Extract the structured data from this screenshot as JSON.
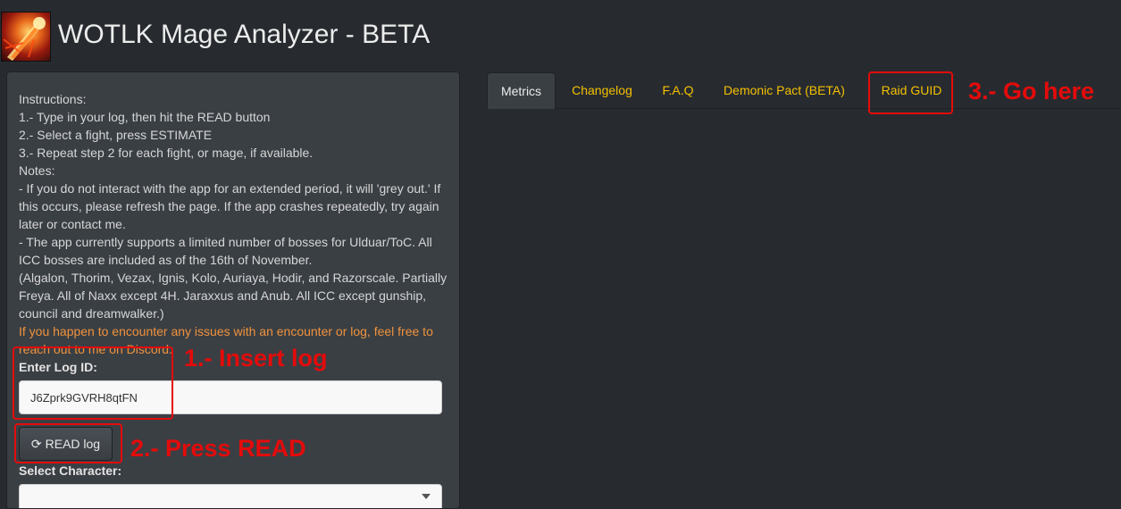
{
  "app": {
    "title": "WOTLK Mage Analyzer - BETA",
    "logo_icon": "mage-spell-icon"
  },
  "sidebar": {
    "instructions": [
      "Instructions:",
      "1.- Type in your log, then hit the READ button",
      "2.- Select a fight, press ESTIMATE",
      "3.- Repeat step 2 for each fight, or mage, if available.",
      "Notes:",
      "- If you do not interact with the app for an extended period, it will 'grey out.' If this occurs, please refresh the page. If the app crashes repeatedly, try again later or contact me.",
      "- The app currently supports a limited number of bosses for Ulduar/ToC. All ICC bosses are included as of the 16th of November.",
      "(Algalon, Thorim, Vezax, Ignis, Kolo, Auriaya, Hodir, and Razorscale. Partially Freya. All of Naxx except 4H. Jaraxxus and Anub. All ICC except gunship, council and dreamwalker.)"
    ],
    "warning": "If you happen to encounter any issues with an encounter or log, feel free to reach out to me on Discord.",
    "log_label": "Enter Log ID:",
    "log_value": "J6Zprk9GVRH8qtFN",
    "read_button": "READ log",
    "read_icon": "refresh-icon",
    "character_label": "Select Character:",
    "character_value": ""
  },
  "tabs": [
    {
      "label": "Metrics",
      "active": true
    },
    {
      "label": "Changelog",
      "active": false
    },
    {
      "label": "F.A.Q",
      "active": false
    },
    {
      "label": "Demonic Pact (BETA)",
      "active": false
    },
    {
      "label": "Raid GUID",
      "active": false
    }
  ],
  "annotations": {
    "step1": "1.- Insert log",
    "step2": "2.- Press READ",
    "step3": "3.- Go here",
    "color": "#e40b0b"
  },
  "colors": {
    "background": "#272b30",
    "panel": "#3a3f44",
    "tab_text": "#f5c000",
    "warning_text": "#f0923c"
  }
}
